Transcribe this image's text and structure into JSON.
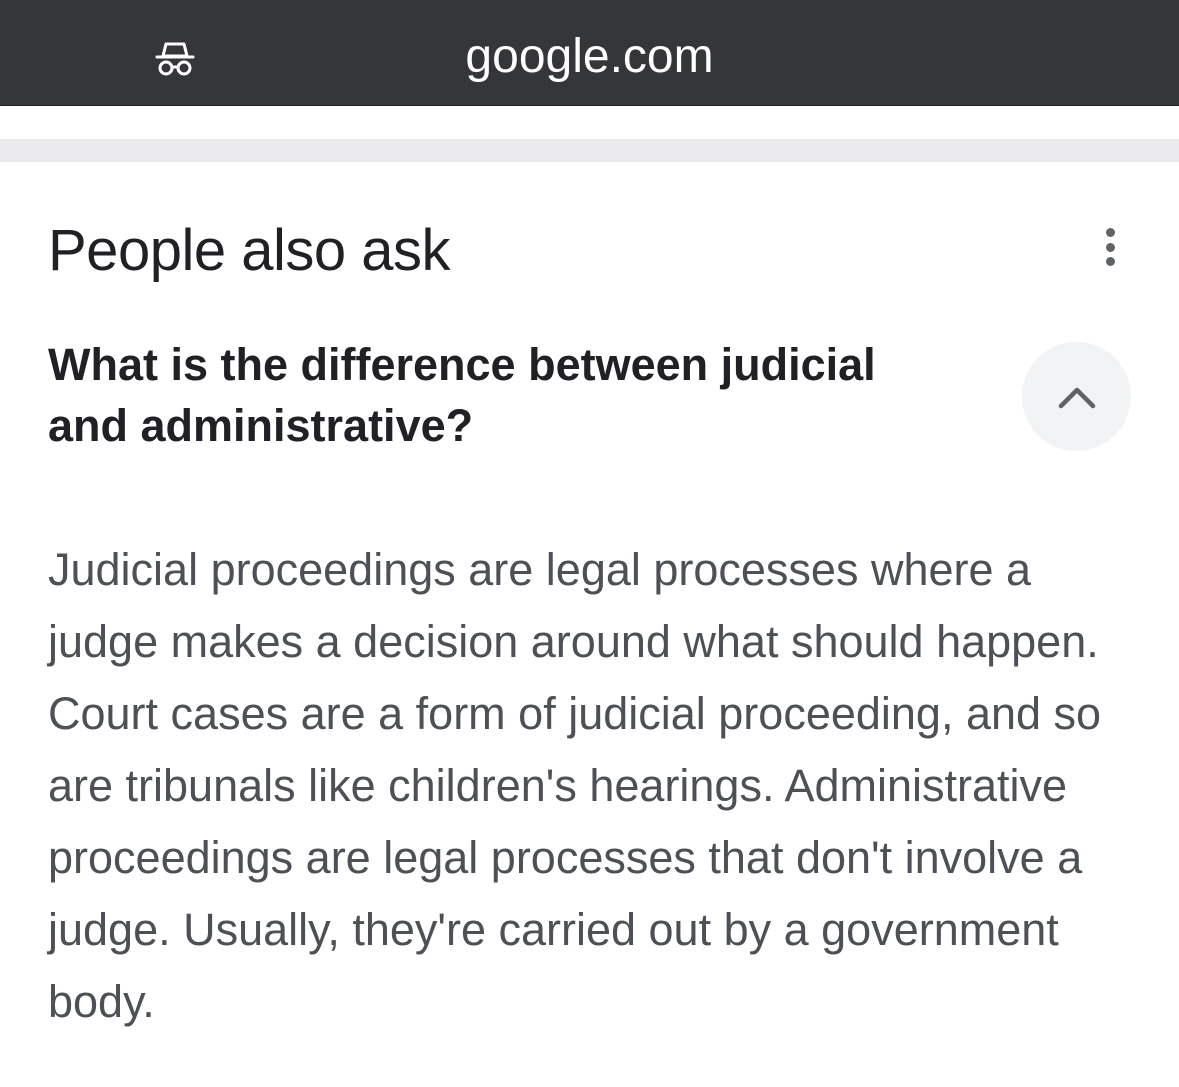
{
  "browser": {
    "url": "google.com",
    "incognito_icon": "incognito-icon"
  },
  "people_also_ask": {
    "title": "People also ask",
    "menu_icon": "more-vert-icon",
    "question": "What is the difference between judicial and administrative?",
    "expanded_icon": "chevron-up-icon",
    "answer": "Judicial proceedings are legal processes where a judge makes a decision around what should happen. Court cases are a form of judicial proceeding, and so are tribunals like children's hearings. Administrative proceedings are legal processes that don't involve a judge. Usually, they're carried out by a government body."
  }
}
